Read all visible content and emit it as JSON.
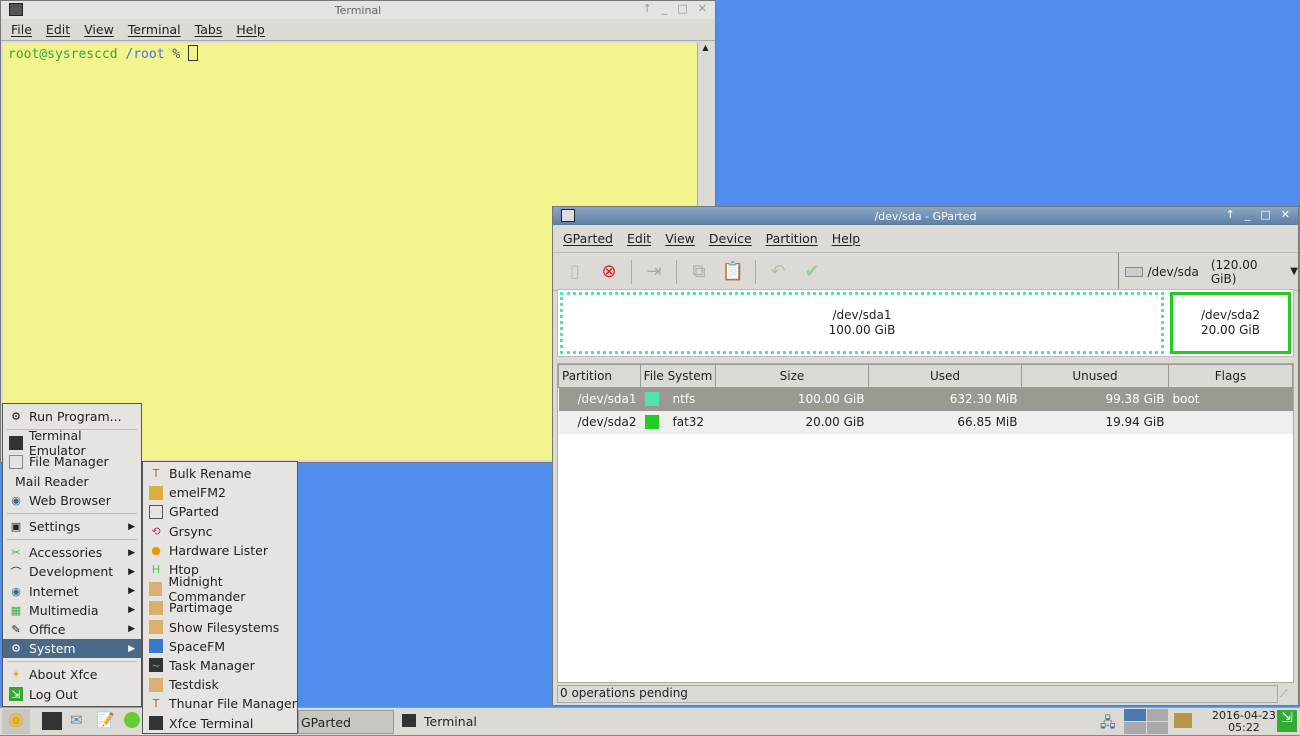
{
  "terminal": {
    "title": "Terminal",
    "menu": [
      "File",
      "Edit",
      "View",
      "Terminal",
      "Tabs",
      "Help"
    ],
    "prompt_user": "root@sysresccd",
    "prompt_path": "/root",
    "prompt_sym": "%"
  },
  "gparted": {
    "title": "/dev/sda - GParted",
    "menu": [
      "GParted",
      "Edit",
      "View",
      "Device",
      "Partition",
      "Help"
    ],
    "device": "/dev/sda",
    "device_size": "(120.00 GiB)",
    "map": [
      {
        "name": "/dev/sda1",
        "size": "100.00 GiB",
        "color": "#4fe3b0"
      },
      {
        "name": "/dev/sda2",
        "size": "20.00 GiB",
        "color": "#22cc22"
      }
    ],
    "columns": [
      "Partition",
      "File System",
      "Size",
      "Used",
      "Unused",
      "Flags"
    ],
    "rows": [
      {
        "partition": "/dev/sda1",
        "fs": "ntfs",
        "fs_color": "#4fe3b0",
        "size": "100.00 GiB",
        "used": "632.30 MiB",
        "unused": "99.38 GiB",
        "flags": "boot"
      },
      {
        "partition": "/dev/sda2",
        "fs": "fat32",
        "fs_color": "#22cc22",
        "size": "20.00 GiB",
        "used": "66.85 MiB",
        "unused": "19.94 GiB",
        "flags": ""
      }
    ],
    "status": "0 operations pending"
  },
  "main_menu": [
    "Run Program...",
    "Terminal Emulator",
    "File Manager",
    "Mail Reader",
    "Web Browser",
    "Settings",
    "Accessories",
    "Development",
    "Internet",
    "Multimedia",
    "Office",
    "System",
    "About Xfce",
    "Log Out"
  ],
  "system_menu": [
    "Bulk Rename",
    "emelFM2",
    "GParted",
    "Grsync",
    "Hardware Lister",
    "Htop",
    "Midnight Commander",
    "Partimage",
    "Show Filesystems",
    "SpaceFM",
    "Task Manager",
    "Testdisk",
    "Thunar File Manager",
    "Xfce Terminal"
  ],
  "taskbar": {
    "task1": "GParted",
    "task2": "Terminal",
    "date": "2016-04-23",
    "time": "05:22"
  }
}
